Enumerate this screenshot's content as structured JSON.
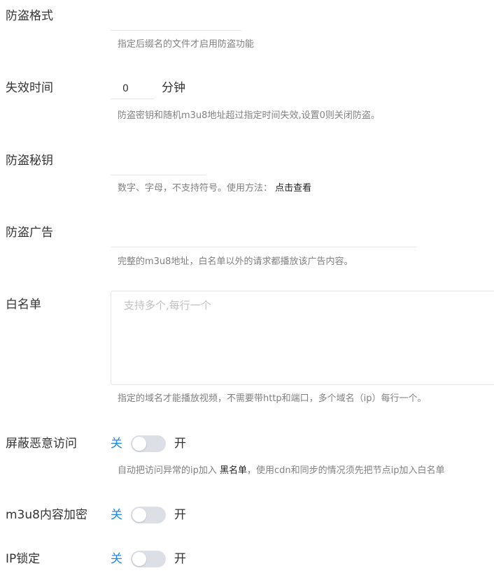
{
  "fields": {
    "hotlink_format": {
      "label": "防盗格式",
      "value": "",
      "hint": "指定后缀名的文件才启用防盗功能"
    },
    "expire_time": {
      "label": "失效时间",
      "value": "0",
      "unit": "分钟",
      "hint": "防盗密钥和随机m3u8地址超过指定时间失效,设置0则关闭防盗。"
    },
    "hotlink_key": {
      "label": "防盗秘钥",
      "value": "",
      "hint_prefix": "数字、字母，不支持符号。使用方法：",
      "hint_link": "点击查看"
    },
    "hotlink_ad": {
      "label": "防盗广告",
      "value": "",
      "hint": "完整的m3u8地址，白名单以外的请求都播放该广告内容。"
    },
    "whitelist": {
      "label": "白名单",
      "placeholder": "支持多个,每行一个",
      "hint": "指定的域名才能播放视频，不需要带http和端口，多个域名（ip）每行一个。"
    },
    "block_malicious": {
      "label": "屏蔽恶意访问",
      "off_label": "关",
      "on_label": "开",
      "state": "off",
      "hint_prefix": "自动把访问异常的ip加入",
      "hint_link": "黑名单",
      "hint_suffix": "，使用cdn和同步的情况须先把节点ip加入白名单"
    },
    "m3u8_encrypt": {
      "label": "m3u8内容加密",
      "off_label": "关",
      "on_label": "开",
      "state": "off"
    },
    "ip_lock": {
      "label": "IP锁定",
      "off_label": "关",
      "on_label": "开",
      "state": "off"
    }
  },
  "colors": {
    "switch_off_label": "#1e88e5",
    "switch_track": "#dcdfe6",
    "hint_text": "#808080",
    "border": "#e6e6e6"
  }
}
